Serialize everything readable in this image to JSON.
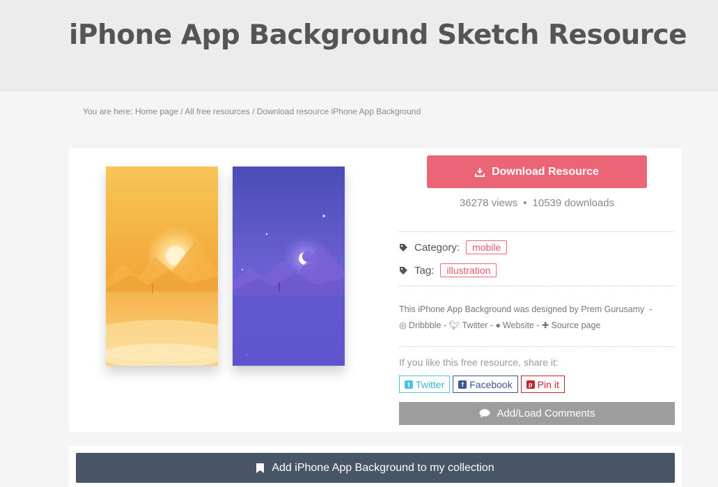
{
  "page": {
    "title": "iPhone App Background Sketch Resource"
  },
  "breadcrumb": {
    "prefix": "You are here:",
    "items": [
      "Home page",
      "All free resources",
      "Download resource iPhone App Background"
    ]
  },
  "download": {
    "label": "Download Resource",
    "icon": "download-icon"
  },
  "stats": {
    "views": "36278 views",
    "separator": "•",
    "downloads": "10539 downloads"
  },
  "meta": {
    "category_label": "Category:",
    "category_value": "mobile",
    "tag_label": "Tag:",
    "tag_value": "illustration"
  },
  "credit": {
    "text": "This iPhone App Background was designed by Prem Gurusamy",
    "links": [
      "Dribbble",
      "Twitter",
      "Website",
      "Source page"
    ]
  },
  "share": {
    "prompt": "If you like this free resource, share it:",
    "twitter": "Twitter",
    "facebook": "Facebook",
    "pinterest": "Pin it"
  },
  "comments": {
    "label": "Add/Load Comments"
  },
  "collection": {
    "label": "Add iPhone App Background to my collection"
  },
  "colors": {
    "download_bg": "#ec6576",
    "comments_bg": "#9d9d9d",
    "collection_bg": "#485566",
    "pill_border": "#e86a7b"
  }
}
